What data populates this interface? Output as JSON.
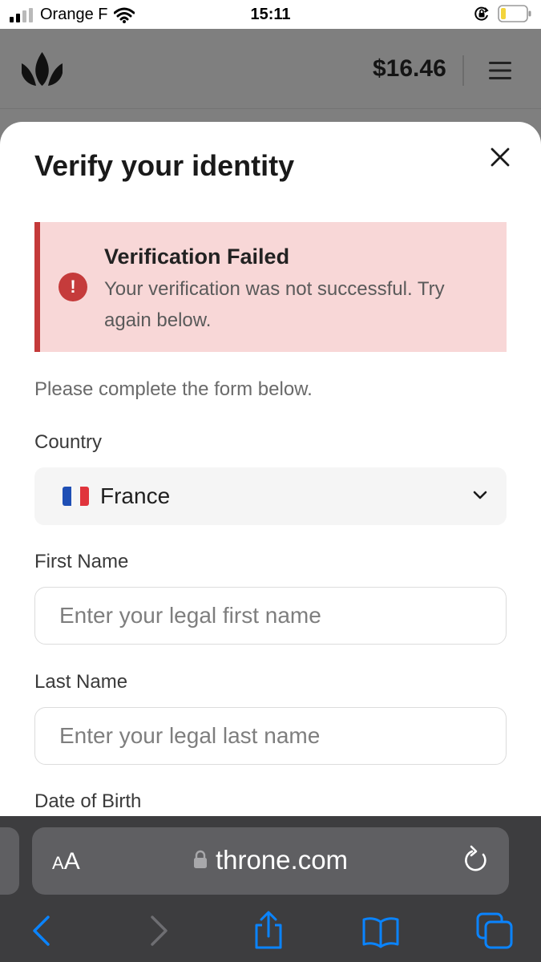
{
  "status_bar": {
    "carrier": "Orange F",
    "time": "15:11"
  },
  "header": {
    "balance": "$16.46"
  },
  "modal": {
    "title": "Verify your identity",
    "alert": {
      "title": "Verification Failed",
      "message": "Your verification was not successful. Try again below.",
      "icon": "!"
    },
    "intro": "Please complete the form below.",
    "fields": {
      "country": {
        "label": "Country",
        "value": "France"
      },
      "first_name": {
        "label": "First Name",
        "placeholder": "Enter your legal first name"
      },
      "last_name": {
        "label": "Last Name",
        "placeholder": "Enter your legal last name"
      },
      "dob": {
        "label": "Date of Birth"
      }
    }
  },
  "browser": {
    "aa_small": "A",
    "aa_large": "A",
    "url": "throne.com"
  },
  "colors": {
    "alert_bg": "#f8d7d7",
    "alert_accent": "#c43a3a",
    "ios_blue": "#0a84ff"
  },
  "icons": [
    "signal-icon",
    "wifi-icon",
    "orientation-lock-icon",
    "battery-icon",
    "crown-logo-icon",
    "menu-icon",
    "close-icon",
    "alert-icon",
    "chevron-down-icon",
    "lock-icon",
    "reload-icon",
    "back-icon",
    "forward-icon",
    "share-icon",
    "bookmarks-icon",
    "tabs-icon"
  ]
}
